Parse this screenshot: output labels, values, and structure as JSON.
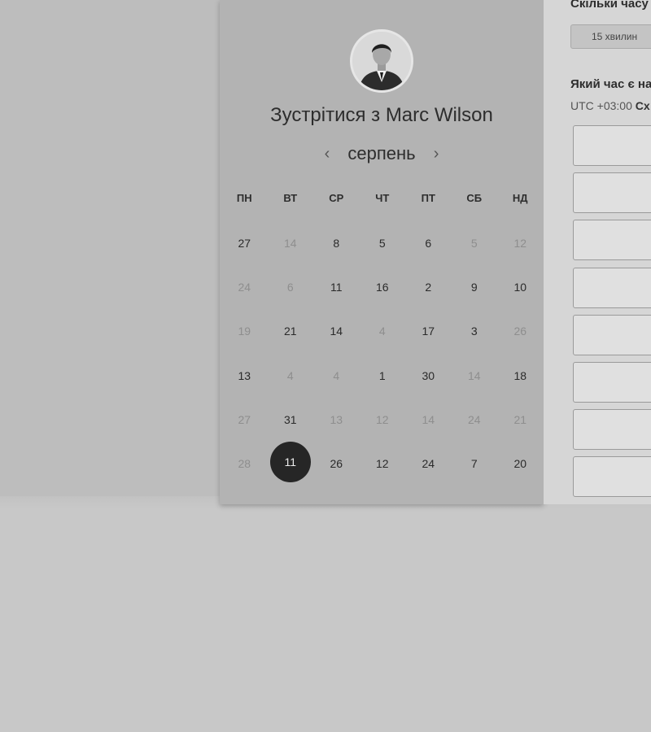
{
  "booking": {
    "meet_prefix": "Зустрітися з",
    "host_name": "Marc Wilson",
    "avatar_icon": "person-portrait-icon"
  },
  "calendar": {
    "month": "серпень",
    "prev_icon": "chevron-left-icon",
    "next_icon": "chevron-right-icon",
    "prev_glyph": "‹",
    "next_glyph": "›",
    "weekdays": [
      "ПН",
      "ВТ",
      "СР",
      "ЧТ",
      "ПТ",
      "СБ",
      "НД"
    ],
    "weeks": [
      [
        {
          "d": "27",
          "muted": false
        },
        {
          "d": "14",
          "muted": true
        },
        {
          "d": "8",
          "muted": false
        },
        {
          "d": "5",
          "muted": false
        },
        {
          "d": "6",
          "muted": false
        },
        {
          "d": "5",
          "muted": true
        },
        {
          "d": "12",
          "muted": true
        }
      ],
      [
        {
          "d": "24",
          "muted": true
        },
        {
          "d": "6",
          "muted": true
        },
        {
          "d": "11",
          "muted": false
        },
        {
          "d": "16",
          "muted": false
        },
        {
          "d": "2",
          "muted": false
        },
        {
          "d": "9",
          "muted": false
        },
        {
          "d": "10",
          "muted": false
        }
      ],
      [
        {
          "d": "19",
          "muted": true
        },
        {
          "d": "21",
          "muted": false
        },
        {
          "d": "14",
          "muted": false
        },
        {
          "d": "4",
          "muted": true
        },
        {
          "d": "17",
          "muted": false
        },
        {
          "d": "3",
          "muted": false
        },
        {
          "d": "26",
          "muted": true
        }
      ],
      [
        {
          "d": "13",
          "muted": false
        },
        {
          "d": "4",
          "muted": true
        },
        {
          "d": "4",
          "muted": true
        },
        {
          "d": "1",
          "muted": false
        },
        {
          "d": "30",
          "muted": false
        },
        {
          "d": "14",
          "muted": true
        },
        {
          "d": "18",
          "muted": false
        }
      ],
      [
        {
          "d": "27",
          "muted": true
        },
        {
          "d": "31",
          "muted": false
        },
        {
          "d": "13",
          "muted": true
        },
        {
          "d": "12",
          "muted": true
        },
        {
          "d": "14",
          "muted": true
        },
        {
          "d": "24",
          "muted": true
        },
        {
          "d": "21",
          "muted": true
        }
      ],
      [
        {
          "d": "28",
          "muted": true
        },
        {
          "d": "11",
          "muted": false,
          "selected": true
        },
        {
          "d": "26",
          "muted": false
        },
        {
          "d": "12",
          "muted": false
        },
        {
          "d": "24",
          "muted": false
        },
        {
          "d": "7",
          "muted": false
        },
        {
          "d": "20",
          "muted": false
        }
      ]
    ]
  },
  "scheduler": {
    "duration_heading": "Скільки часу",
    "duration_option": "15 хвилин",
    "time_heading": "Який час є на",
    "timezone_offset": "UTC +03:00",
    "timezone_name": "Сх"
  },
  "colors": {
    "selected_day_bg": "#262626",
    "panel_bg": "#b3b3b3",
    "page_bg": "#c8c8c8"
  }
}
